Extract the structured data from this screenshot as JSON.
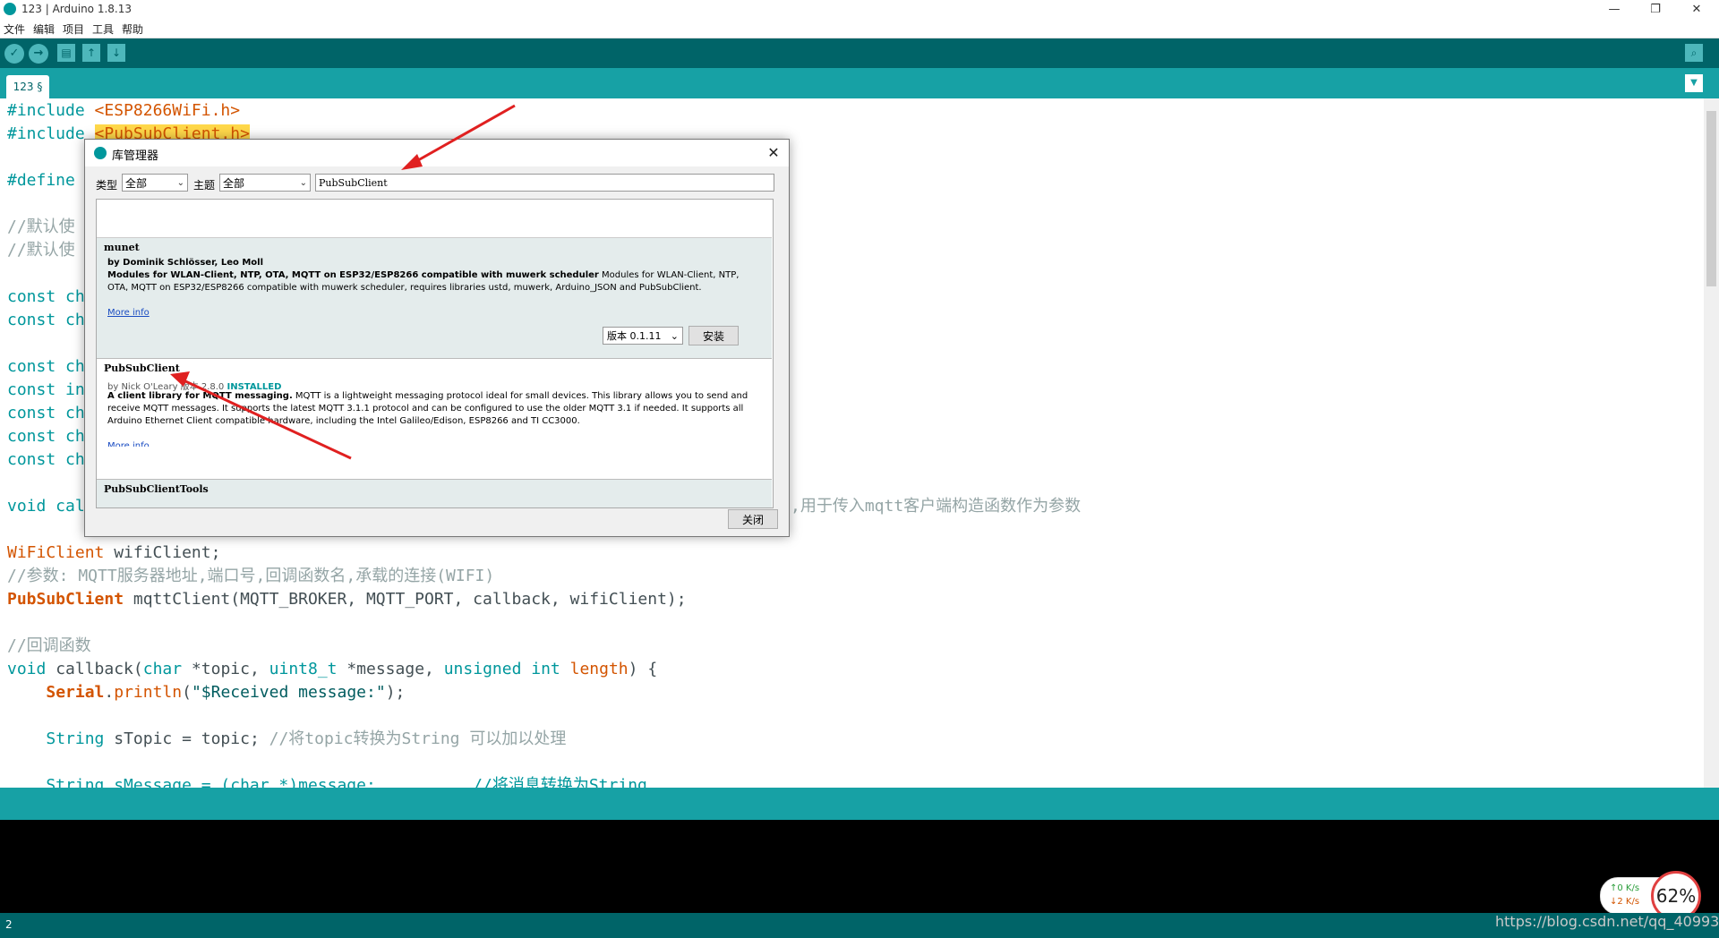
{
  "window": {
    "title": "123 | Arduino 1.8.13",
    "min_icon": "—",
    "max_icon": "❐",
    "close_icon": "✕"
  },
  "menu": [
    "文件",
    "编辑",
    "项目",
    "工具",
    "帮助"
  ],
  "toolbar": {
    "verify_icon": "✓",
    "upload_icon": "→",
    "new_icon": "▤",
    "open_icon": "↑",
    "save_icon": "↓",
    "serial_icon": "⌕"
  },
  "tab": {
    "label": "123 §",
    "menu_icon": "▼"
  },
  "code": {
    "l1_pre": "#include ",
    "l1_inc": "<ESP8266WiFi.h>",
    "l2_pre": "#include ",
    "l2_inc": "<PubSubClient.h>",
    "l3": "#define ",
    "l4": "//默认使",
    "l5": "//默认使",
    "l6": "const ch",
    "l7": "const ch",
    "l8": "const ch",
    "l9": "const in",
    "l10": "const ch",
    "l11": "const ch",
    "l12": "const ch",
    "l13_pre": "void cal",
    "l13_cm": ",用于传入mqtt客户端构造函数作为参数",
    "l14_ty": "WiFiClient",
    "l14_rest": " wifiClient;",
    "l15": "//参数: MQTT服务器地址,端口号,回调函数名,承载的连接(WIFI)",
    "l16_ty": "PubSubClient",
    "l16_rest": " mqttClient(MQTT_BROKER, MQTT_PORT, callback, wifiClient);",
    "l17": "//回调函数",
    "l18_a": "void ",
    "l18_b": "callback(",
    "l18_c": "char",
    "l18_d": " *topic, ",
    "l18_e": "uint8_t",
    "l18_f": " *message, ",
    "l18_g": "unsigned int",
    "l18_h": " ",
    "l18_i": "length",
    "l18_j": ") {",
    "l19_a": "    ",
    "l19_b": "Serial",
    "l19_c": ".",
    "l19_d": "println",
    "l19_e": "(",
    "l19_f": "\"$Received message:\"",
    "l19_g": ");",
    "l20_a": "    ",
    "l20_b": "String",
    "l20_c": " sTopic = topic; ",
    "l20_d": "//将topic转换为String 可以加以处理",
    "l21": "    String sMessage = (char *)message;          //将消息转换为String"
  },
  "status": {
    "line": "2",
    "watermark": "https://blog.csdn.net/qq_40993"
  },
  "net": {
    "up": "↑0  K/s",
    "down": "↓2  K/s",
    "cpu": "62%"
  },
  "dialog": {
    "title": "库管理器",
    "close_icon": "✕",
    "type_label": "类型",
    "type_value": "全部",
    "topic_label": "主题",
    "topic_value": "全部",
    "search_value": "PubSubClient",
    "close_button": "关闭",
    "entries": [
      {
        "name": "munet",
        "by": "by Dominik Schlösser, Leo Moll",
        "desc_bold": "Modules for WLAN-Client, NTP, OTA, MQTT on ESP32/ESP8266 compatible with muwerk scheduler",
        "desc": " Modules for WLAN-Client, NTP, OTA, MQTT on ESP32/ESP8266 compatible with muwerk scheduler, requires libraries ustd, muwerk, Arduino_JSON and PubSubClient.",
        "more": "More info",
        "version": "版本 0.1.11",
        "install": "安装"
      },
      {
        "name": "PubSubClient",
        "by_pre": "by Nick O'Leary 版本 2.8.0 ",
        "installed": "INSTALLED",
        "desc_bold": "A client library for MQTT messaging.",
        "desc": " MQTT is a lightweight messaging protocol ideal for small devices. This library allows you to send and receive MQTT messages. It supports the latest MQTT 3.1.1 protocol and can be configured to use the older MQTT 3.1 if needed. It supports all Arduino Ethernet Client compatible hardware, including the Intel Galileo/Edison, ESP8266 and TI CC3000.",
        "more": "More info"
      },
      {
        "name": "PubSubClientTools"
      }
    ]
  }
}
